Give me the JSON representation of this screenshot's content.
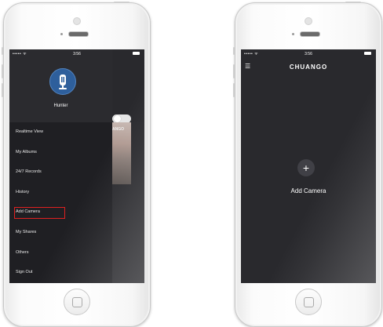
{
  "status_bar": {
    "signal": "••••• ᯤ",
    "time": "3:56"
  },
  "left_phone": {
    "user_name": "Hunter",
    "menu": [
      {
        "label": "Realtime View"
      },
      {
        "label": "My Albums"
      },
      {
        "label": "24/7 Records"
      },
      {
        "label": "History"
      },
      {
        "label": "Add Camera"
      },
      {
        "label": "My Shares"
      },
      {
        "label": "Others"
      },
      {
        "label": "Sign Out"
      }
    ],
    "peek_logo": "ANGO"
  },
  "right_phone": {
    "menu_icon": "☰",
    "brand": "CHUANGO",
    "add_icon": "+",
    "add_label": "Add Camera"
  },
  "colors": {
    "screen_bg": "#29292d",
    "drawer_bg": "#1f1f23",
    "highlight": "#e02020",
    "avatar": "#2e5f9c"
  }
}
